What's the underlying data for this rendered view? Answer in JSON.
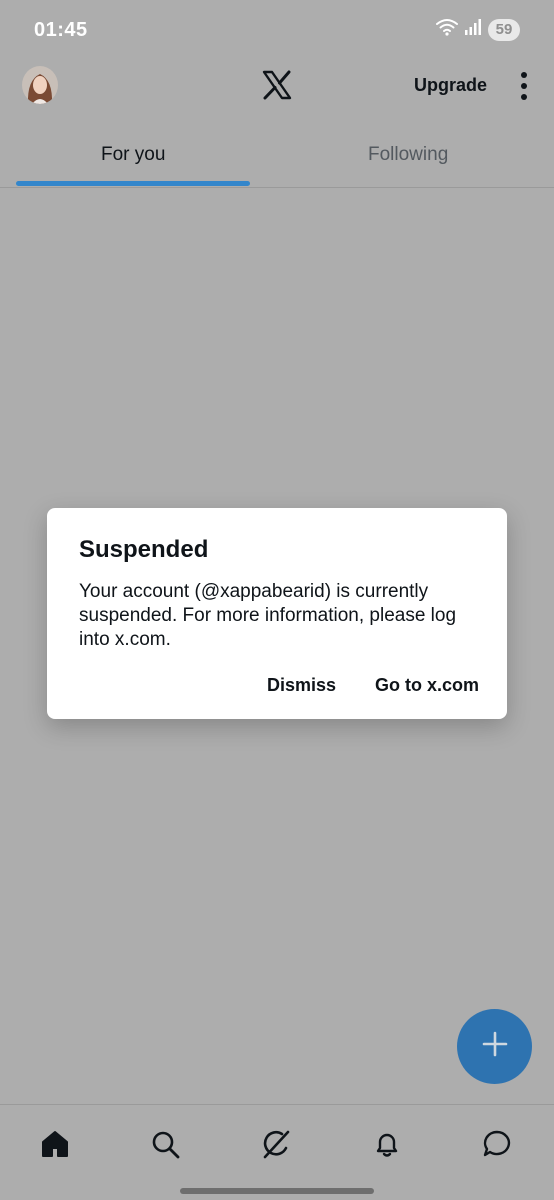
{
  "status_bar": {
    "time": "01:45",
    "battery": "59",
    "icons": [
      "wifi-icon",
      "signal-icon",
      "battery-icon"
    ]
  },
  "app_bar": {
    "logo": "X",
    "upgrade_label": "Upgrade",
    "icons": [
      "avatar",
      "x-logo-icon",
      "more-vertical-icon"
    ]
  },
  "tabs": [
    {
      "label": "For you",
      "selected": true
    },
    {
      "label": "Following",
      "selected": false
    }
  ],
  "dialog": {
    "title": "Suspended",
    "body": "Your account (@xappabearid) is currently suspended. For more information, please log into x.com.",
    "dismiss_label": "Dismiss",
    "goto_label": "Go to x.com"
  },
  "fab": {
    "icon": "plus-icon"
  },
  "bottom_nav": {
    "items": [
      "home-icon",
      "search-icon",
      "grok-icon",
      "notifications-icon",
      "messages-icon"
    ]
  },
  "colors": {
    "overlay_background": "#adadad",
    "accent": "#1d7fd0",
    "fab": "#2e73b0",
    "dialog_background": "#ffffff",
    "text_primary": "#0f1419"
  }
}
